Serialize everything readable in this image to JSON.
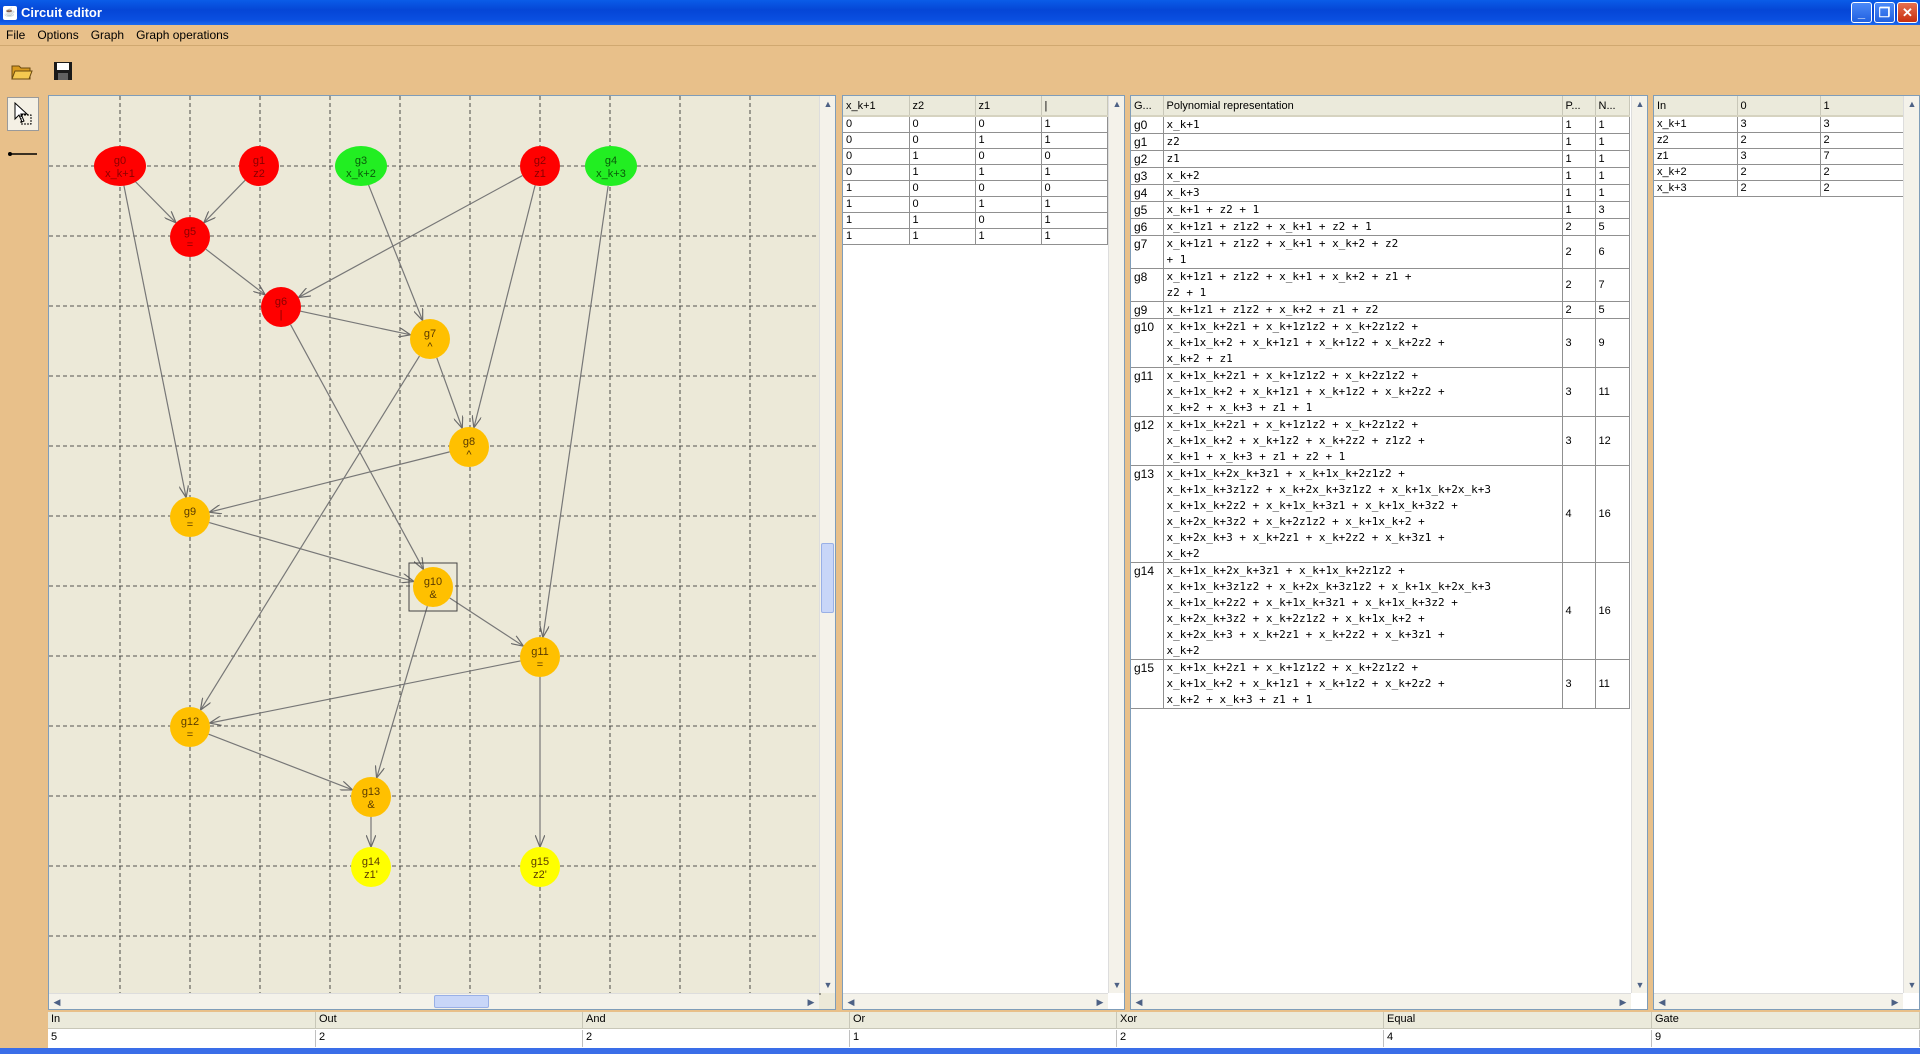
{
  "window": {
    "title": "Circuit editor"
  },
  "menu": [
    {
      "label": "File"
    },
    {
      "label": "Options"
    },
    {
      "label": "Graph"
    },
    {
      "label": "Graph operations"
    }
  ],
  "toolbar": {
    "open_icon": "folder-open-icon",
    "save_icon": "floppy-disk-icon"
  },
  "tools": {
    "select_icon": "pointer-select-icon",
    "edge_icon": "line-edge-icon"
  },
  "colors": {
    "input_red": "#ff0000",
    "input_green": "#22ee22",
    "gate_orange": "#ffc000",
    "output_yellow": "#ffff00"
  },
  "graph": {
    "nodes": [
      {
        "id": "g0",
        "label": "g0",
        "sub": "x_k+1",
        "kind": "input-red"
      },
      {
        "id": "g1",
        "label": "g1",
        "sub": "z2",
        "kind": "input-red"
      },
      {
        "id": "g3",
        "label": "g3",
        "sub": "x_k+2",
        "kind": "input-green"
      },
      {
        "id": "g2",
        "label": "g2",
        "sub": "z1",
        "kind": "input-red"
      },
      {
        "id": "g4",
        "label": "g4",
        "sub": "x_k+3",
        "kind": "input-green"
      },
      {
        "id": "g5",
        "label": "g5",
        "sub": "=",
        "kind": "gate-red"
      },
      {
        "id": "g6",
        "label": "g6",
        "sub": "|",
        "kind": "gate-red"
      },
      {
        "id": "g7",
        "label": "g7",
        "sub": "^",
        "kind": "gate"
      },
      {
        "id": "g8",
        "label": "g8",
        "sub": "^",
        "kind": "gate"
      },
      {
        "id": "g9",
        "label": "g9",
        "sub": "=",
        "kind": "gate"
      },
      {
        "id": "g10",
        "label": "g10",
        "sub": "&",
        "kind": "gate"
      },
      {
        "id": "g11",
        "label": "g11",
        "sub": "=",
        "kind": "gate"
      },
      {
        "id": "g12",
        "label": "g12",
        "sub": "=",
        "kind": "gate"
      },
      {
        "id": "g13",
        "label": "g13",
        "sub": "&",
        "kind": "gate"
      },
      {
        "id": "g14",
        "label": "g14",
        "sub": "z1'",
        "kind": "output"
      },
      {
        "id": "g15",
        "label": "g15",
        "sub": "z2'",
        "kind": "output"
      }
    ],
    "edges": [
      [
        "g0",
        "g5"
      ],
      [
        "g1",
        "g5"
      ],
      [
        "g5",
        "g6"
      ],
      [
        "g2",
        "g6"
      ],
      [
        "g6",
        "g7"
      ],
      [
        "g3",
        "g7"
      ],
      [
        "g7",
        "g8"
      ],
      [
        "g2",
        "g8"
      ],
      [
        "g0",
        "g9"
      ],
      [
        "g8",
        "g9"
      ],
      [
        "g9",
        "g10"
      ],
      [
        "g6",
        "g10"
      ],
      [
        "g10",
        "g11"
      ],
      [
        "g4",
        "g11"
      ],
      [
        "g11",
        "g12"
      ],
      [
        "g7",
        "g12"
      ],
      [
        "g12",
        "g13"
      ],
      [
        "g10",
        "g13"
      ],
      [
        "g13",
        "g14"
      ],
      [
        "g11",
        "g15"
      ]
    ]
  },
  "truth": {
    "headers": [
      "x_k+1",
      "z2",
      "z1",
      "|"
    ],
    "rows": [
      [
        "0",
        "0",
        "0",
        "1"
      ],
      [
        "0",
        "0",
        "1",
        "1"
      ],
      [
        "0",
        "1",
        "0",
        "0"
      ],
      [
        "0",
        "1",
        "1",
        "1"
      ],
      [
        "1",
        "0",
        "0",
        "0"
      ],
      [
        "1",
        "0",
        "1",
        "1"
      ],
      [
        "1",
        "1",
        "0",
        "1"
      ],
      [
        "1",
        "1",
        "1",
        "1"
      ]
    ]
  },
  "poly": {
    "headers": [
      "G...",
      "Polynomial representation",
      "P...",
      "N..."
    ],
    "rows": [
      {
        "g": "g0",
        "lines": [
          "x_k+1"
        ],
        "p": "1",
        "n": "1"
      },
      {
        "g": "g1",
        "lines": [
          "z2"
        ],
        "p": "1",
        "n": "1"
      },
      {
        "g": "g2",
        "lines": [
          "z1"
        ],
        "p": "1",
        "n": "1"
      },
      {
        "g": "g3",
        "lines": [
          "x_k+2"
        ],
        "p": "1",
        "n": "1"
      },
      {
        "g": "g4",
        "lines": [
          "x_k+3"
        ],
        "p": "1",
        "n": "1"
      },
      {
        "g": "g5",
        "lines": [
          "x_k+1 + z2 + 1"
        ],
        "p": "1",
        "n": "3"
      },
      {
        "g": "g6",
        "lines": [
          "x_k+1z1 + z1z2 + x_k+1 + z2 + 1"
        ],
        "p": "2",
        "n": "5"
      },
      {
        "g": "g7",
        "lines": [
          "x_k+1z1 + z1z2 + x_k+1 + x_k+2 + z2",
          "+ 1"
        ],
        "p": "2",
        "n": "6"
      },
      {
        "g": "g8",
        "lines": [
          "x_k+1z1 + z1z2 + x_k+1 + x_k+2 + z1 +",
          "z2 + 1"
        ],
        "p": "2",
        "n": "7"
      },
      {
        "g": "g9",
        "lines": [
          "x_k+1z1 + z1z2 + x_k+2 + z1 + z2"
        ],
        "p": "2",
        "n": "5"
      },
      {
        "g": "g10",
        "lines": [
          "x_k+1x_k+2z1 + x_k+1z1z2 + x_k+2z1z2 +",
          "x_k+1x_k+2 + x_k+1z1 + x_k+1z2 + x_k+2z2 +",
          "x_k+2 + z1"
        ],
        "p": "3",
        "n": "9"
      },
      {
        "g": "g11",
        "lines": [
          "x_k+1x_k+2z1 + x_k+1z1z2 + x_k+2z1z2 +",
          "x_k+1x_k+2 + x_k+1z1 + x_k+1z2 + x_k+2z2 +",
          "x_k+2 + x_k+3 + z1 + 1"
        ],
        "p": "3",
        "n": "11"
      },
      {
        "g": "g12",
        "lines": [
          "x_k+1x_k+2z1 + x_k+1z1z2 + x_k+2z1z2 +",
          "x_k+1x_k+2 + x_k+1z2 + x_k+2z2 + z1z2 +",
          "x_k+1 + x_k+3 + z1 + z2 + 1"
        ],
        "p": "3",
        "n": "12"
      },
      {
        "g": "g13",
        "lines": [
          "x_k+1x_k+2x_k+3z1 + x_k+1x_k+2z1z2 +",
          "x_k+1x_k+3z1z2 + x_k+2x_k+3z1z2 + x_k+1x_k+2x_k+3",
          "x_k+1x_k+2z2 + x_k+1x_k+3z1 + x_k+1x_k+3z2 +",
          "x_k+2x_k+3z2 + x_k+2z1z2 + x_k+1x_k+2 +",
          "x_k+2x_k+3 + x_k+2z1 + x_k+2z2 + x_k+3z1 +",
          "x_k+2"
        ],
        "p": "4",
        "n": "16"
      },
      {
        "g": "g14",
        "lines": [
          "x_k+1x_k+2x_k+3z1 + x_k+1x_k+2z1z2 +",
          "x_k+1x_k+3z1z2 + x_k+2x_k+3z1z2 + x_k+1x_k+2x_k+3",
          "x_k+1x_k+2z2 + x_k+1x_k+3z1 + x_k+1x_k+3z2 +",
          "x_k+2x_k+3z2 + x_k+2z1z2 + x_k+1x_k+2 +",
          "x_k+2x_k+3 + x_k+2z1 + x_k+2z2 + x_k+3z1 +",
          "x_k+2"
        ],
        "p": "4",
        "n": "16"
      },
      {
        "g": "g15",
        "lines": [
          "x_k+1x_k+2z1 + x_k+1z1z2 + x_k+2z1z2 +",
          "x_k+1x_k+2 + x_k+1z1 + x_k+1z2 + x_k+2z2 +",
          "x_k+2 + x_k+3 + z1 + 1"
        ],
        "p": "3",
        "n": "11"
      }
    ]
  },
  "counts": {
    "headers": [
      "In",
      "0",
      "1"
    ],
    "rows": [
      [
        "x_k+1",
        "3",
        "3"
      ],
      [
        "z2",
        "2",
        "2"
      ],
      [
        "z1",
        "3",
        "7"
      ],
      [
        "x_k+2",
        "2",
        "2"
      ],
      [
        "x_k+3",
        "2",
        "2"
      ]
    ]
  },
  "status": {
    "headers": [
      "In",
      "Out",
      "And",
      "Or",
      "Xor",
      "Equal",
      "Gate"
    ],
    "values": [
      "5",
      "2",
      "2",
      "1",
      "2",
      "4",
      "9"
    ]
  }
}
